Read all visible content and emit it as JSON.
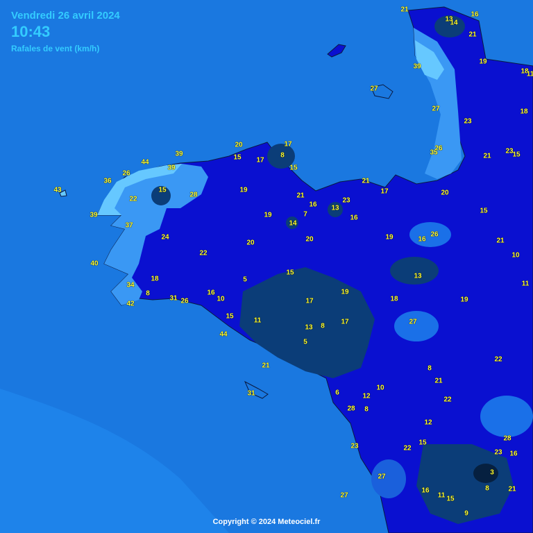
{
  "header": {
    "date": "Vendredi 26 avril 2024",
    "time": "10:43",
    "description": "Rafales de vent (km/h)"
  },
  "copyright": "Copyright © 2024 Meteociel.fr",
  "colors": {
    "sea": "#1a78e0",
    "land_mid": "#0a10d0",
    "land_light": "#4aa8f8",
    "land_dark": "#0b3d78",
    "labels": "#ffff33"
  },
  "station_values": [
    "21",
    "13",
    "14",
    "16",
    "21",
    "39",
    "19",
    "18",
    "11",
    "27",
    "27",
    "23",
    "18",
    "23",
    "15",
    "35",
    "26",
    "21",
    "17",
    "20",
    "8",
    "15",
    "39",
    "15",
    "44",
    "17",
    "26",
    "21",
    "39",
    "36",
    "15",
    "19",
    "43",
    "22",
    "28",
    "21",
    "16",
    "7",
    "23",
    "17",
    "39",
    "13",
    "16",
    "37",
    "19",
    "14",
    "20",
    "15",
    "24",
    "20",
    "20",
    "19",
    "16",
    "26",
    "21",
    "40",
    "22",
    "15",
    "10",
    "18",
    "5",
    "13",
    "34",
    "8",
    "31",
    "26",
    "16",
    "10",
    "17",
    "19",
    "18",
    "19",
    "11",
    "42",
    "15",
    "11",
    "27",
    "13",
    "8",
    "17",
    "44",
    "5",
    "22",
    "21",
    "8",
    "21",
    "10",
    "6",
    "12",
    "31",
    "28",
    "8",
    "22",
    "12",
    "28",
    "15",
    "23",
    "22",
    "23",
    "16",
    "3",
    "27",
    "16",
    "11",
    "15",
    "8",
    "21",
    "27",
    "9"
  ]
}
